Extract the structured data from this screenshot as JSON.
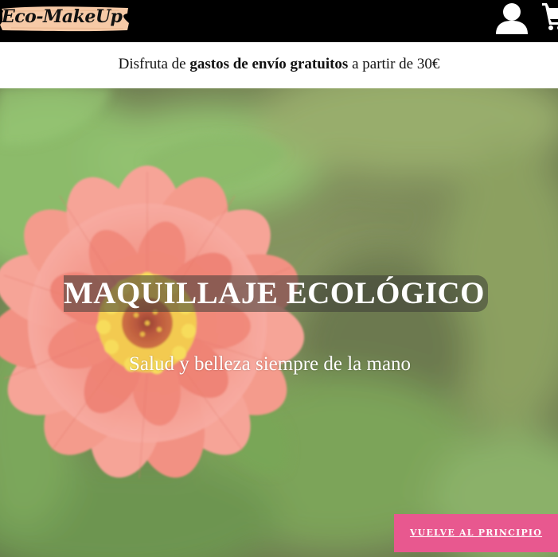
{
  "header": {
    "logo_text": "Eco-MakeUp",
    "user_icon": "user-icon",
    "cart_icon": "cart-icon"
  },
  "promo": {
    "before": "Disfruta de ",
    "bold": "gastos de envío gratuitos",
    "after": " a partir de 30€"
  },
  "hero": {
    "title": "MAQUILLAJE ECOLÓGICO",
    "subtitle": "Salud y belleza siempre de la mano"
  },
  "back_to_top": {
    "label": "VUELVE AL PRINCIPIO"
  },
  "colors": {
    "header_bg": "#000000",
    "logo_brush": "#f6c9a6",
    "button_bg": "#e8588f",
    "flower": "#f2897a",
    "foliage": "#6fa34f"
  }
}
